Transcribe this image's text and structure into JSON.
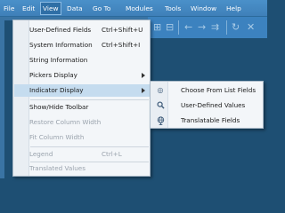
{
  "menubar": {
    "items": [
      {
        "label": "File",
        "ul": "F"
      },
      {
        "label": "Edit",
        "ul": "E"
      },
      {
        "label": "View",
        "ul": "V"
      },
      {
        "label": "Data",
        "ul": "D"
      },
      {
        "label": "Go To",
        "ul": "G"
      },
      {
        "label": "Modules",
        "ul": "M"
      },
      {
        "label": "Tools",
        "ul": "T"
      },
      {
        "label": "Window",
        "ul": "W"
      },
      {
        "label": "Help",
        "ul": "H"
      }
    ],
    "active": "View"
  },
  "toolbar": {
    "icons": [
      "expand-icon",
      "collapse-icon",
      "back-arrow-icon",
      "forward-arrow-icon",
      "forward-arrow-icon",
      "redo-icon",
      "close-icon"
    ]
  },
  "view_menu": {
    "items": [
      {
        "label": "User-Defined Fields",
        "shortcut": "Ctrl+Shift+U",
        "enabled": true
      },
      {
        "label": "System Information",
        "shortcut": "Ctrl+Shift+I",
        "enabled": true
      },
      {
        "label": "String Information",
        "shortcut": "",
        "enabled": true
      },
      {
        "label": "Pickers Display",
        "shortcut": "",
        "enabled": true,
        "submenu": true
      },
      {
        "label": "Indicator Display",
        "shortcut": "",
        "enabled": true,
        "submenu": true,
        "highlighted": true
      },
      {
        "label": "Show/Hide Toolbar",
        "shortcut": "",
        "enabled": true
      },
      {
        "label": "Restore Column Width",
        "shortcut": "",
        "enabled": false
      },
      {
        "label": "Fit Column Width",
        "shortcut": "",
        "enabled": false
      },
      {
        "label": "Legend",
        "shortcut": "Ctrl+L",
        "enabled": false
      },
      {
        "label": "Translated Values",
        "shortcut": "",
        "enabled": false
      }
    ]
  },
  "indicator_submenu": {
    "items": [
      {
        "label": "Choose From List Fields",
        "icon": "choose-from-list-icon"
      },
      {
        "label": "User-Defined Values",
        "icon": "magnifier-icon"
      },
      {
        "label": "Translatable Fields",
        "icon": "globe-icon"
      }
    ]
  }
}
